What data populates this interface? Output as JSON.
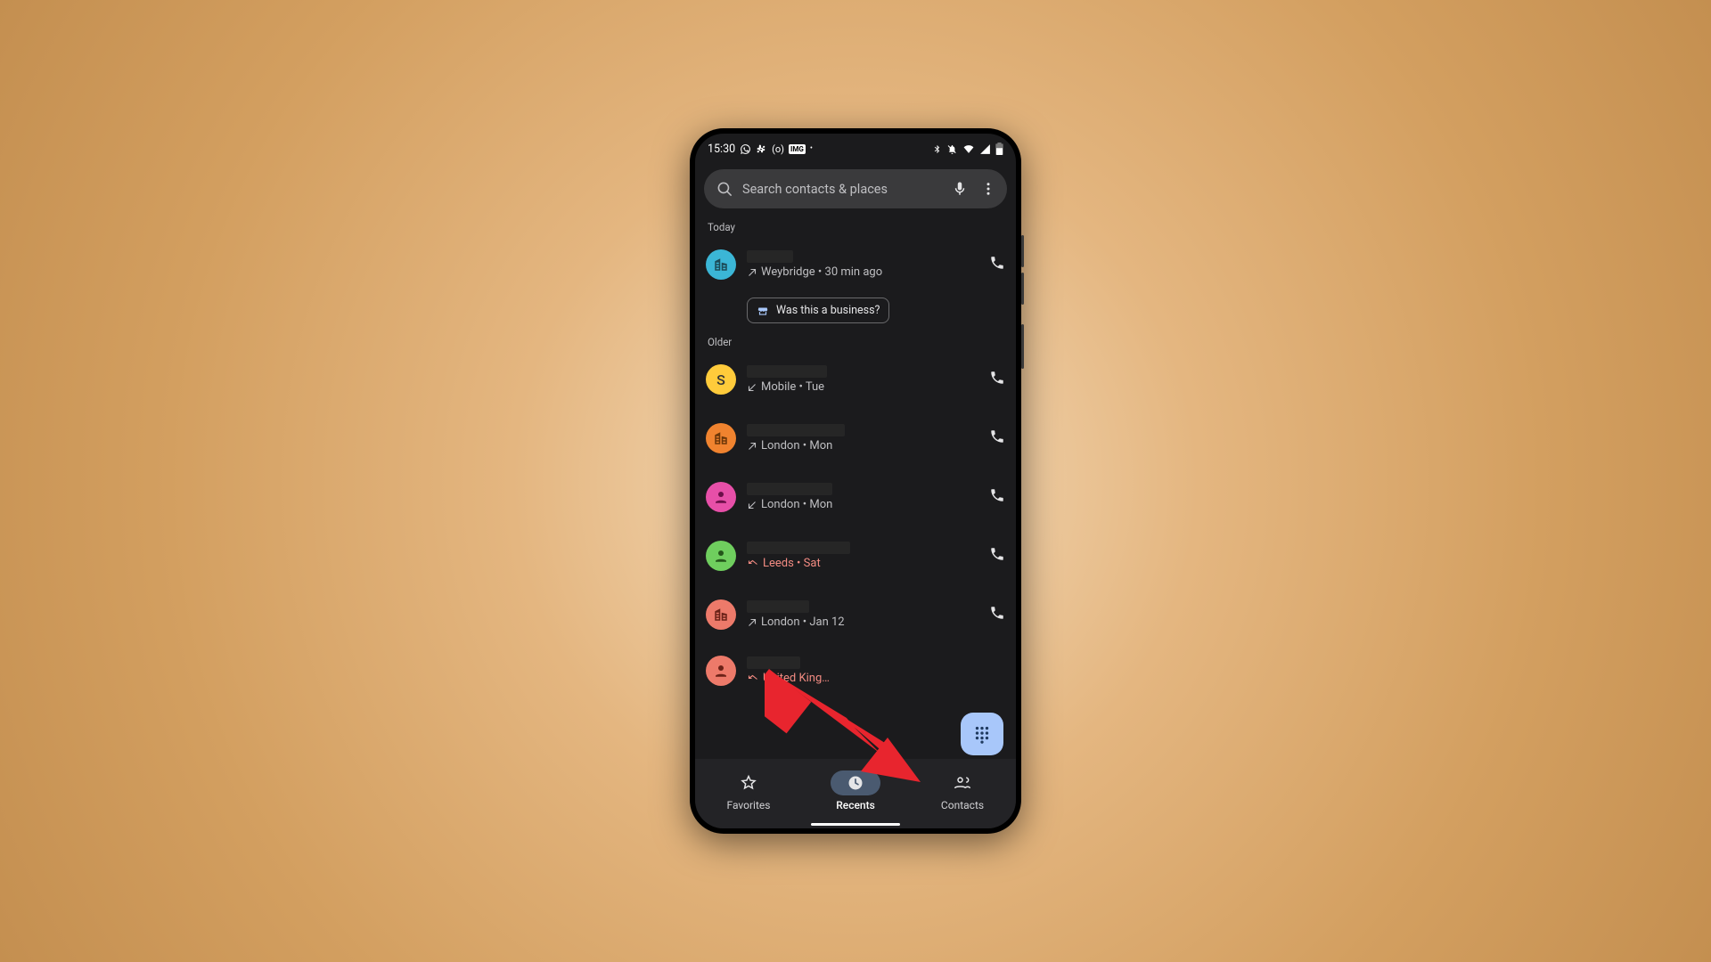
{
  "status": {
    "time": "15:30",
    "badge": "(o)",
    "img_chip": "IMG"
  },
  "search": {
    "placeholder": "Search contacts & places"
  },
  "sections": {
    "today": "Today",
    "older": "Older"
  },
  "chip": "Was this a business?",
  "calls": [
    {
      "avatar": {
        "bg": "#3bb6d6",
        "type": "biz"
      },
      "meta": "Weybridge • 30 min ago",
      "dir": "out",
      "missed": false
    },
    {
      "avatar": {
        "bg": "#ffcb3b",
        "type": "letter",
        "letter": "S"
      },
      "meta": "Mobile • Tue",
      "dir": "in",
      "missed": false
    },
    {
      "avatar": {
        "bg": "#f0832f",
        "type": "biz"
      },
      "meta": "London • Mon",
      "dir": "out",
      "missed": false
    },
    {
      "avatar": {
        "bg": "#e74fa8",
        "type": "person"
      },
      "meta": "London • Mon",
      "dir": "in",
      "missed": false
    },
    {
      "avatar": {
        "bg": "#6fce5e",
        "type": "person"
      },
      "meta": "Leeds • Sat",
      "dir": "missed",
      "missed": true
    },
    {
      "avatar": {
        "bg": "#ed7a6a",
        "type": "biz"
      },
      "meta": "London • Jan 12",
      "dir": "out",
      "missed": false
    },
    {
      "avatar": {
        "bg": "#ed7a6a",
        "type": "person"
      },
      "meta": "United King…",
      "dir": "missed",
      "missed": true
    }
  ],
  "nav": {
    "fav": "Favorites",
    "rec": "Recents",
    "con": "Contacts"
  }
}
